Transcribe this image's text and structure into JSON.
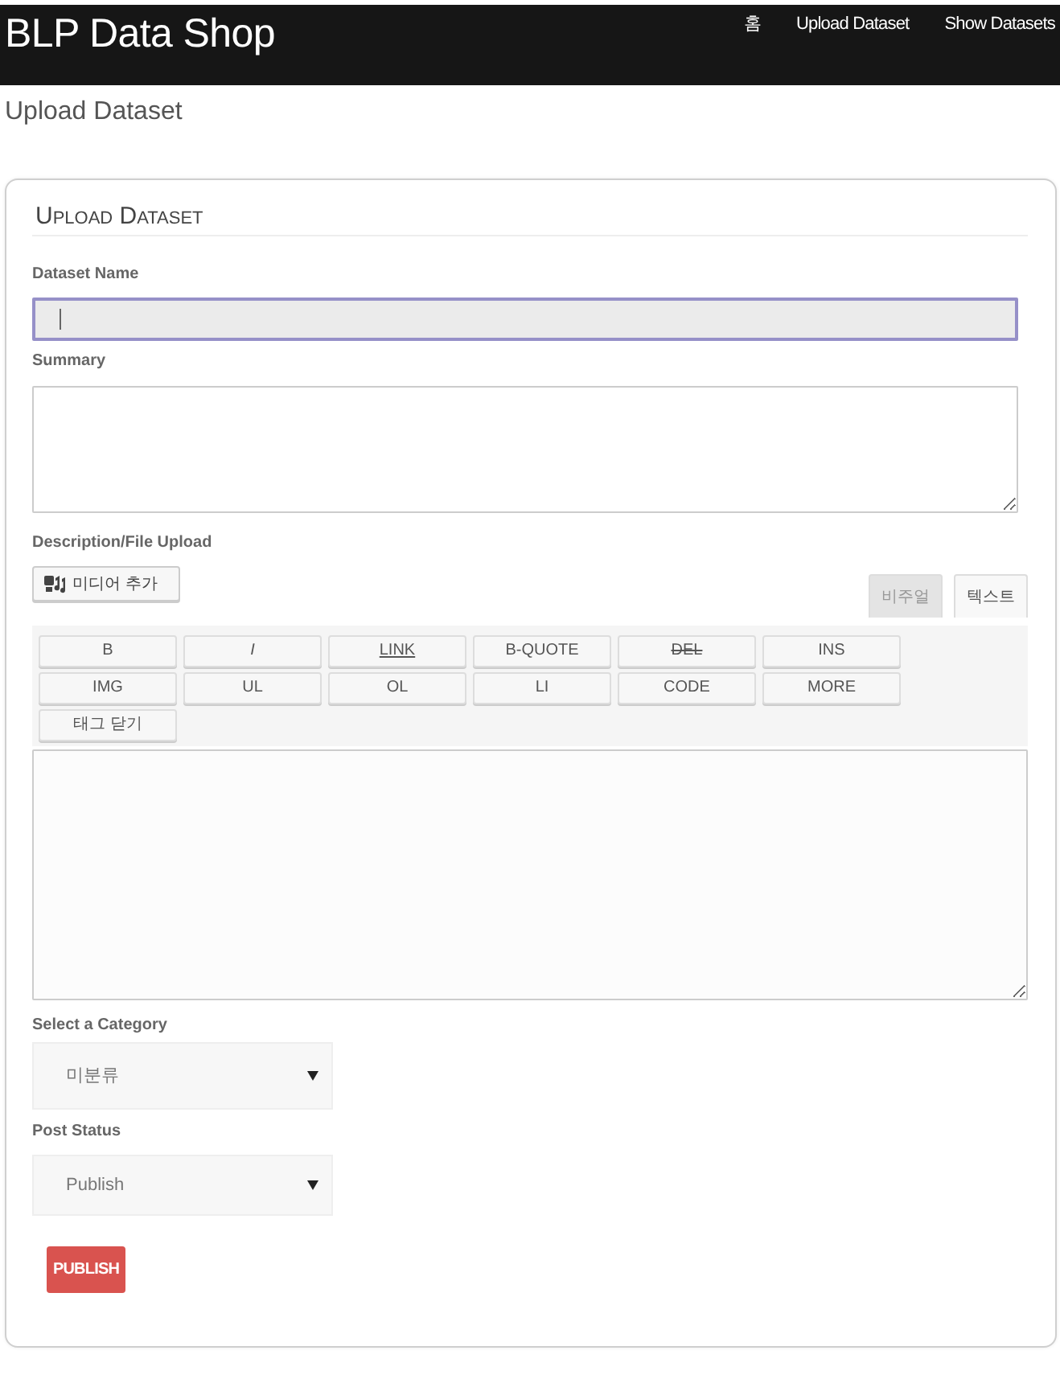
{
  "navbar": {
    "brand": "BLP Data Shop",
    "links": [
      {
        "label": "홈"
      },
      {
        "label": "Upload Dataset"
      },
      {
        "label": "Show Datasets"
      }
    ]
  },
  "page_title": "Upload Dataset",
  "form": {
    "heading": "Upload Dataset",
    "dataset_name": {
      "label": "Dataset Name",
      "focused": true
    },
    "summary": {
      "label": "Summary"
    },
    "description": {
      "label": "Description/File Upload",
      "media_button": "미디어 추가",
      "editor_tabs": [
        {
          "label": "비주얼",
          "selected": false
        },
        {
          "label": "텍스트",
          "selected": true
        }
      ],
      "quicktags": [
        {
          "label": "B",
          "kind": "plain"
        },
        {
          "label": "I",
          "kind": "italic"
        },
        {
          "label": "LINK",
          "kind": "underline"
        },
        {
          "label": "B-QUOTE",
          "kind": "plain"
        },
        {
          "label": "DEL",
          "kind": "strike"
        },
        {
          "label": "INS",
          "kind": "plain"
        },
        {
          "label": "IMG",
          "kind": "plain"
        },
        {
          "label": "UL",
          "kind": "plain"
        },
        {
          "label": "OL",
          "kind": "plain"
        },
        {
          "label": "LI",
          "kind": "plain"
        },
        {
          "label": "CODE",
          "kind": "plain"
        },
        {
          "label": "MORE",
          "kind": "plain"
        },
        {
          "label": "태그 닫기",
          "kind": "plain"
        }
      ]
    },
    "category": {
      "label": "Select a Category",
      "value": "미분류"
    },
    "post_status": {
      "label": "Post Status",
      "value": "Publish"
    },
    "submit": "PUBLISH"
  }
}
